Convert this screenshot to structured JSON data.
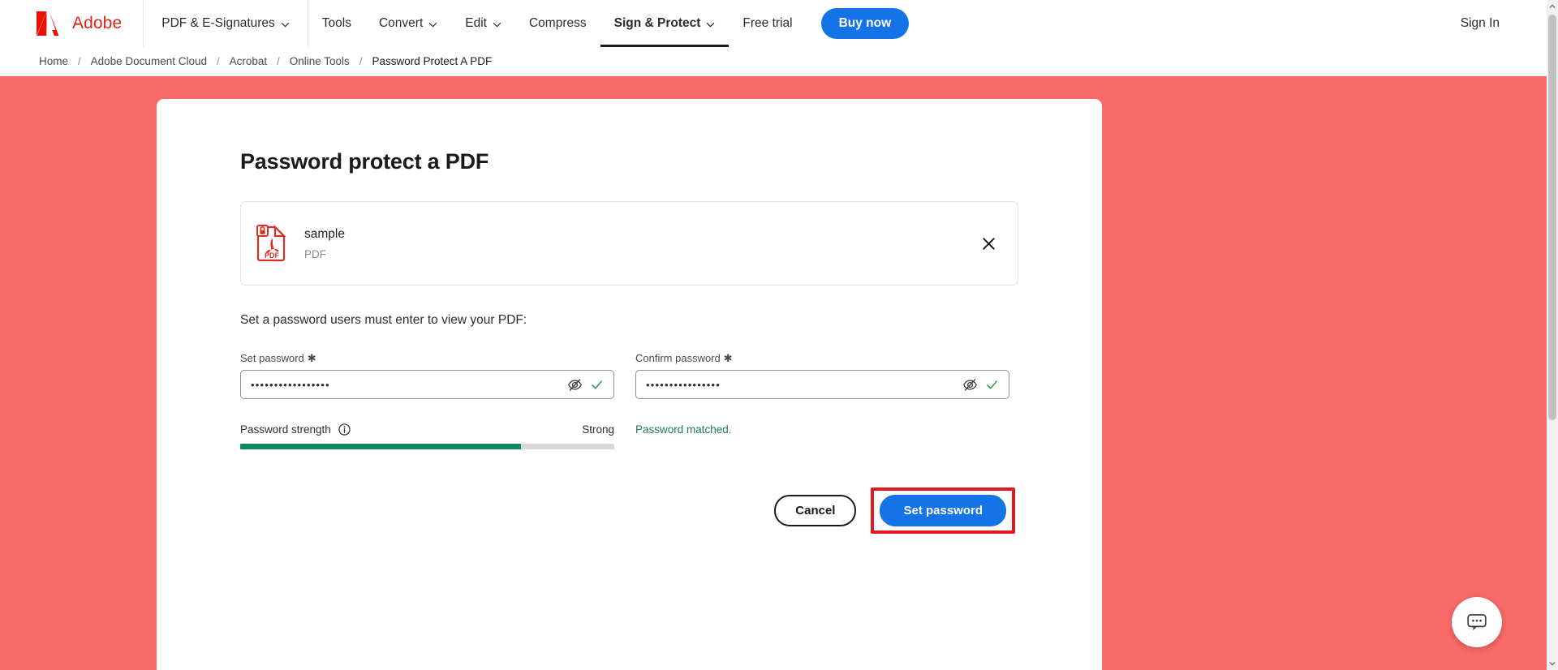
{
  "topnav": {
    "brand": {
      "name": "Adobe",
      "logo_icon": "adobe-logo-icon"
    },
    "items": [
      {
        "label": "PDF & E-Signatures",
        "has_chevron": true,
        "active": false
      },
      {
        "label": "Tools",
        "has_chevron": false,
        "active": false
      },
      {
        "label": "Convert",
        "has_chevron": true,
        "active": false
      },
      {
        "label": "Edit",
        "has_chevron": true,
        "active": false
      },
      {
        "label": "Compress",
        "has_chevron": false,
        "active": false
      },
      {
        "label": "Sign & Protect",
        "has_chevron": true,
        "active": true
      },
      {
        "label": "Free trial",
        "has_chevron": false,
        "active": false
      }
    ],
    "buy_now": "Buy now",
    "sign_in": "Sign In",
    "accent_blue": "#1473e6",
    "brand_red": "#e1251b"
  },
  "breadcrumb": {
    "separator": "/",
    "items": [
      {
        "label": "Home",
        "current": false
      },
      {
        "label": "Adobe Document Cloud",
        "current": false
      },
      {
        "label": "Acrobat",
        "current": false
      },
      {
        "label": "Online Tools",
        "current": false
      },
      {
        "label": "Password Protect A PDF",
        "current": true
      }
    ]
  },
  "canvas": {
    "background_color": "#fa6a68"
  },
  "card": {
    "title": "Password protect a PDF",
    "file": {
      "name": "sample",
      "type": "PDF",
      "icon": "pdf-locked-file-icon",
      "remove_icon": "close-icon"
    },
    "instruction": "Set a password users must enter to view your PDF:",
    "set_password": {
      "label": "Set password",
      "required_marker": "✱",
      "value": "•••••••••••••••••",
      "placeholder": "",
      "toggle_icon": "eye-off-icon",
      "valid_icon": "check-icon"
    },
    "confirm_password": {
      "label": "Confirm password",
      "required_marker": "✱",
      "value": "••••••••••••••••",
      "placeholder": "",
      "toggle_icon": "eye-off-icon",
      "valid_icon": "check-icon",
      "message": "Password matched.",
      "message_color": "#1a7f4b"
    },
    "strength": {
      "label": "Password strength",
      "info_icon": "info-icon",
      "value": "Strong",
      "percent": 75,
      "fill_color": "#0f8a5f",
      "track_color": "#d8d8d8"
    },
    "actions": {
      "cancel": "Cancel",
      "submit": "Set password",
      "submit_color": "#1473e6",
      "highlight_color": "#e01b1b"
    }
  },
  "chat": {
    "icon": "chat-bubble-icon"
  },
  "scrollbar": {
    "up_icon": "chevron-up-icon",
    "down_icon": "chevron-down-icon"
  }
}
